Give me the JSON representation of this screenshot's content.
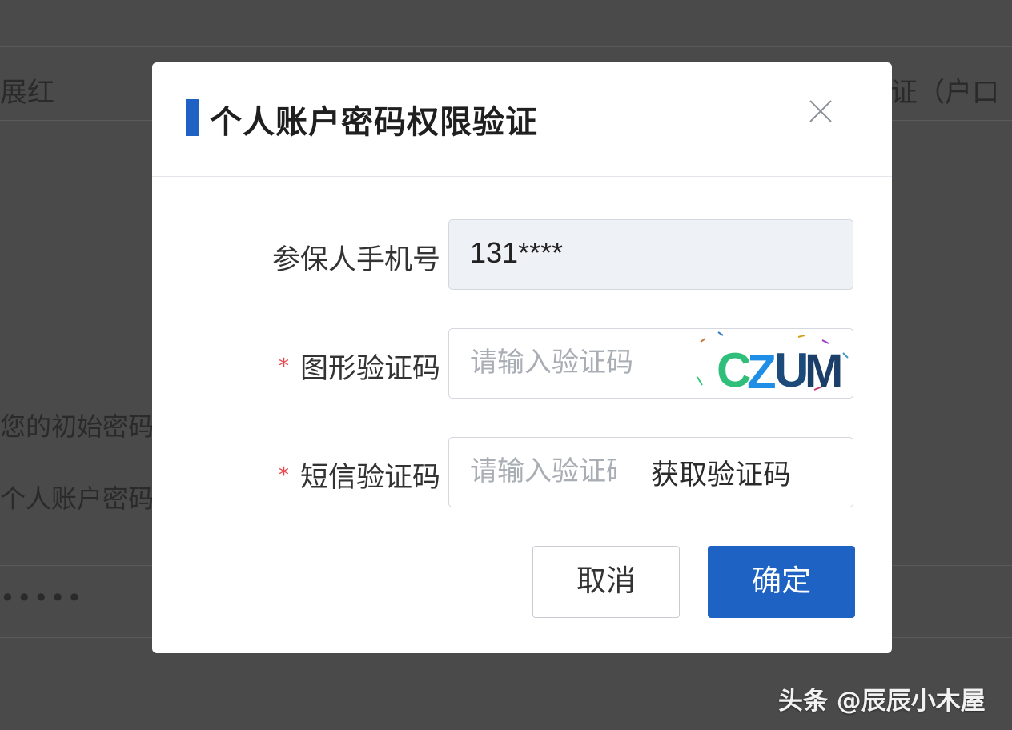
{
  "background": {
    "header_left": "展红",
    "header_right": "证（户口",
    "line1": "您的初始密码",
    "line2": "个人账户密码",
    "masked": "•••••"
  },
  "modal": {
    "title": "个人账户密码权限验证",
    "close_icon": "close-icon",
    "phone": {
      "label": "参保人手机号",
      "value": "131****"
    },
    "captcha": {
      "required_mark": "*",
      "label": "图形验证码",
      "placeholder": "请输入验证码",
      "image_text": "CZUM"
    },
    "sms": {
      "required_mark": "*",
      "label": "短信验证码",
      "placeholder": "请输入验证码",
      "get_code": "获取验证码"
    },
    "cancel_label": "取消",
    "confirm_label": "确定",
    "accent_color": "#1e62c4"
  },
  "watermark": "头条 @辰辰小木屋"
}
